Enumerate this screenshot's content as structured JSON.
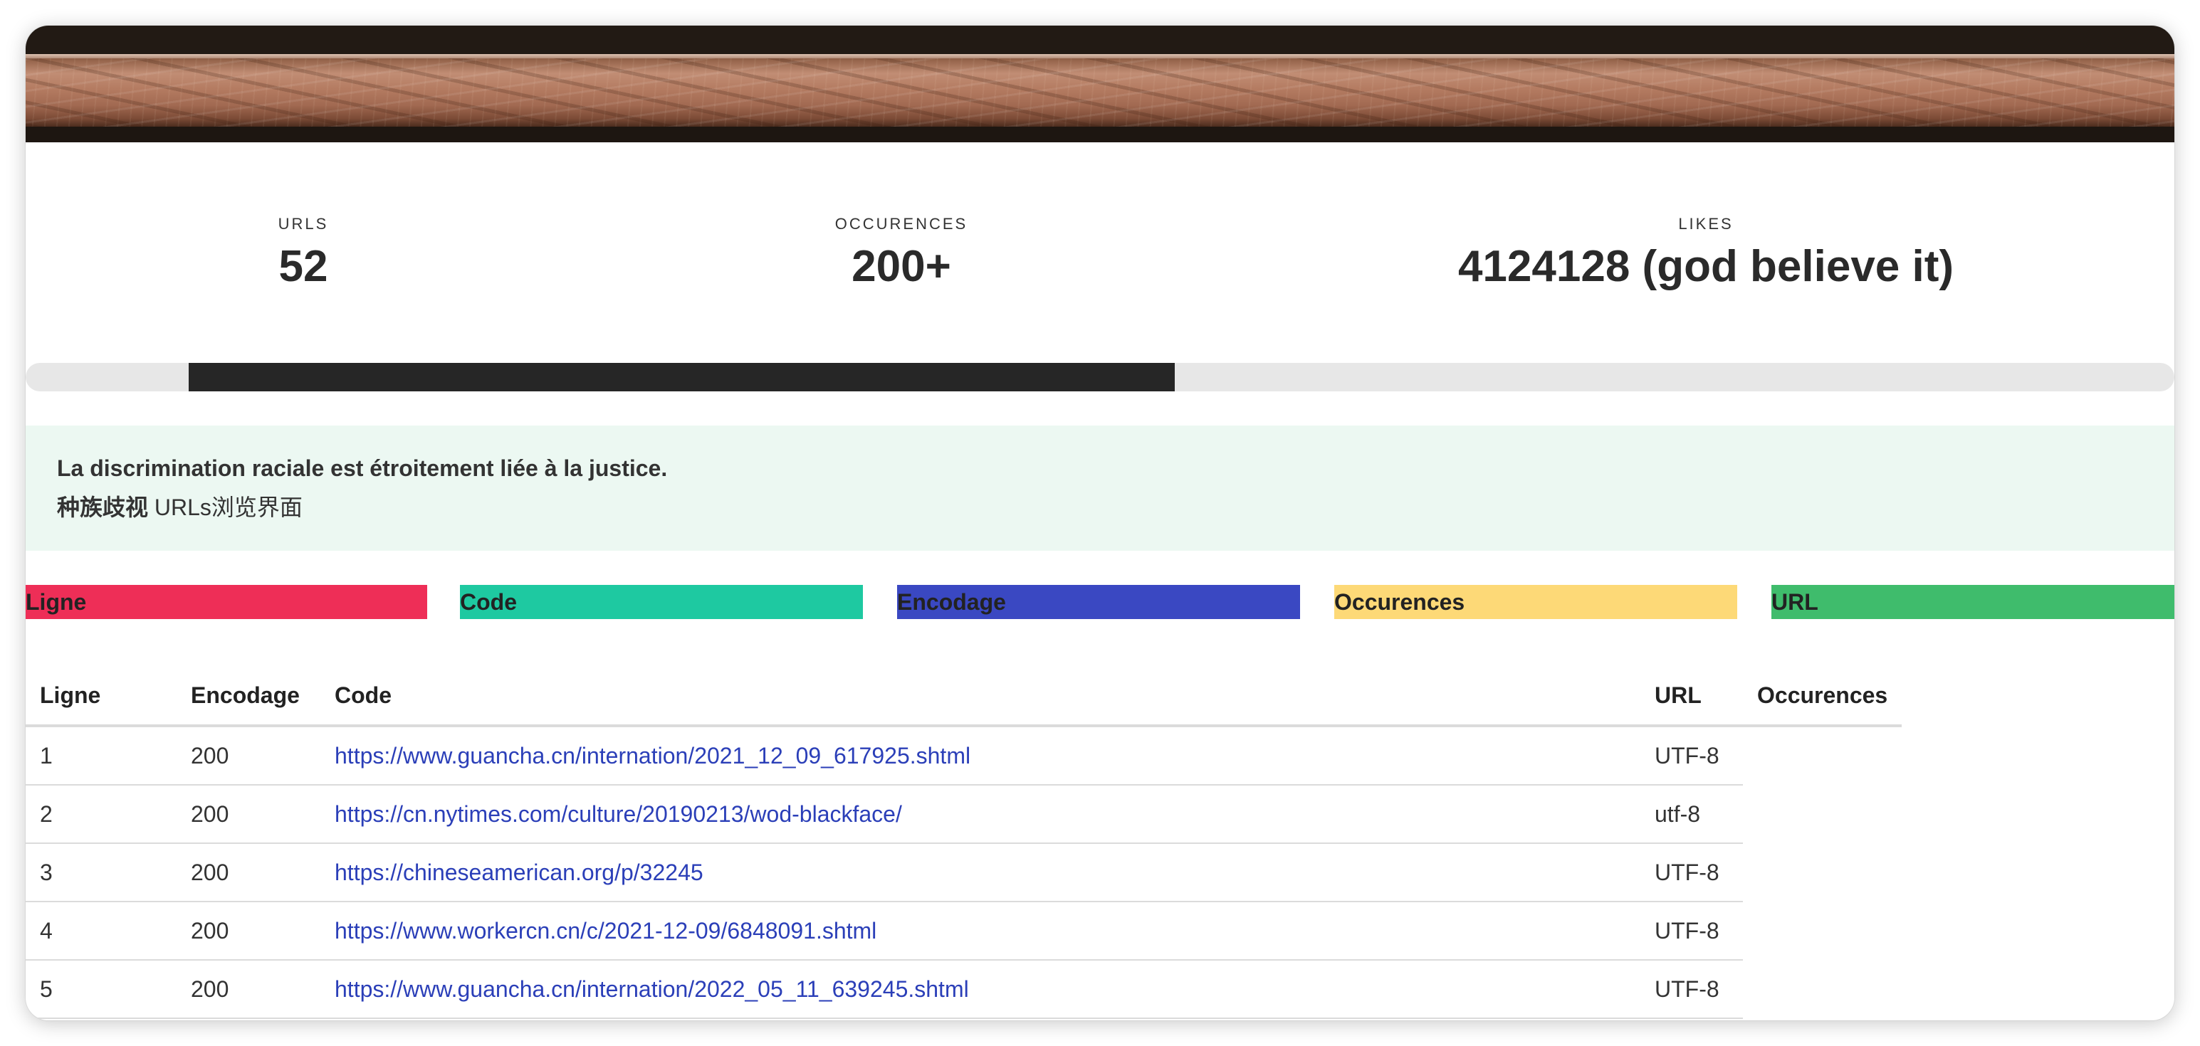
{
  "stats": {
    "urls": {
      "label": "URLS",
      "value": "52"
    },
    "occurrences": {
      "label": "OCCURENCES",
      "value": "200+"
    },
    "likes": {
      "label": "LIKES",
      "value": "4124128 (god believe it)"
    }
  },
  "progress": {
    "start_fraction": 0.076,
    "end_fraction": 0.535,
    "track_color": "#e7e7e7",
    "fill_color": "#262626"
  },
  "notice": {
    "title": "La discrimination raciale est étroitement liée à la justice.",
    "subtitle_bold": "种族歧视",
    "subtitle_rest": " URLs浏览界面",
    "background": "#ecf8f2"
  },
  "legend": [
    {
      "label": "Ligne",
      "color": "#ee2e57"
    },
    {
      "label": "Code",
      "color": "#1ec9a1"
    },
    {
      "label": "Encodage",
      "color": "#3a48c2"
    },
    {
      "label": "Occurences",
      "color": "#fdd977"
    },
    {
      "label": "URL",
      "color": "#3fbc6c"
    }
  ],
  "table": {
    "headers": [
      "Ligne",
      "Encodage",
      "Code",
      "URL",
      "Occurences"
    ],
    "rows": [
      {
        "ligne": "1",
        "encodage": "200",
        "code": "https://www.guancha.cn/internation/2021_12_09_617925.shtml",
        "url": "UTF-8"
      },
      {
        "ligne": "2",
        "encodage": "200",
        "code": "https://cn.nytimes.com/culture/20190213/wod-blackface/",
        "url": "utf-8"
      },
      {
        "ligne": "3",
        "encodage": "200",
        "code": "https://chineseamerican.org/p/32245",
        "url": "UTF-8"
      },
      {
        "ligne": "4",
        "encodage": "200",
        "code": "https://www.workercn.cn/c/2021-12-09/6848091.shtml",
        "url": "UTF-8"
      },
      {
        "ligne": "5",
        "encodage": "200",
        "code": "https://www.guancha.cn/internation/2022_05_11_639245.shtml",
        "url": "UTF-8"
      }
    ]
  }
}
